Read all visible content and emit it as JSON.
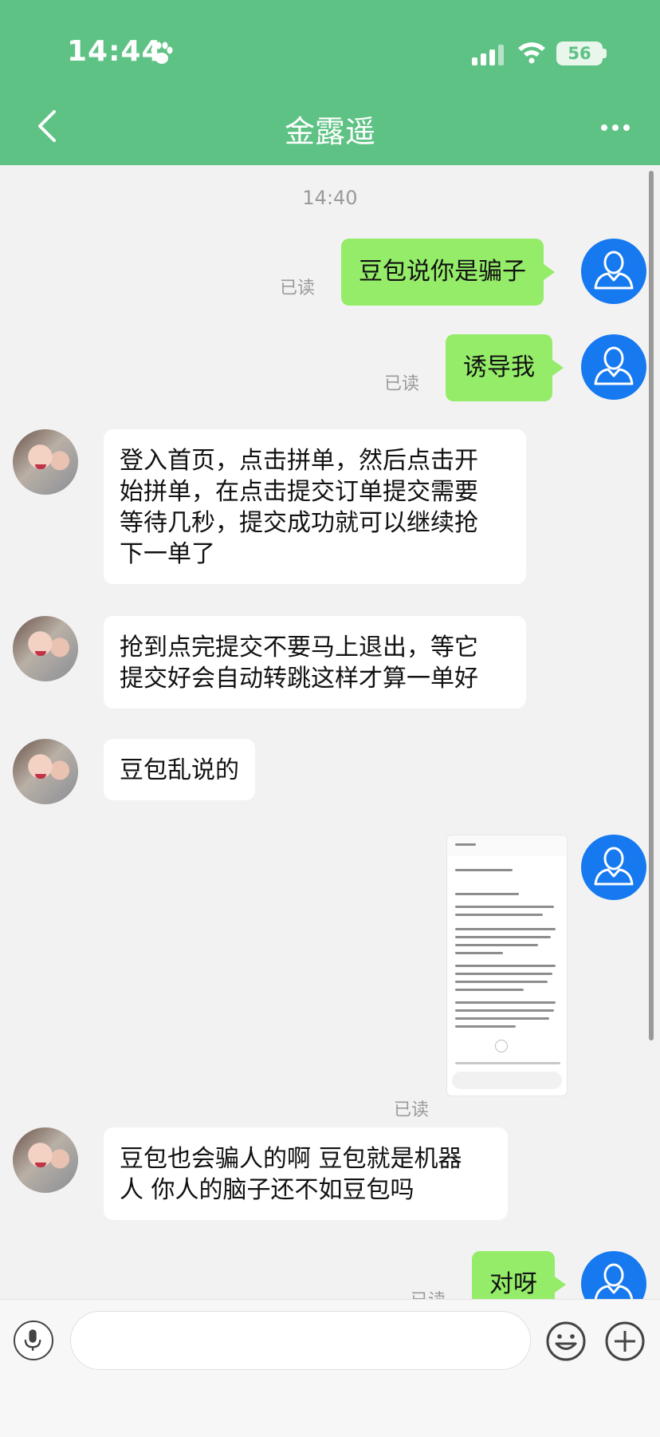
{
  "status_bar": {
    "time": "14:44",
    "battery": "56",
    "icons": [
      "paw-icon",
      "signal-icon",
      "wifi-icon",
      "battery-icon"
    ]
  },
  "header": {
    "title": "金露遥",
    "back_icon": "chevron-left-icon",
    "more_icon": "more-icon"
  },
  "timestamp": "14:40",
  "messages": [
    {
      "id": "m1",
      "side": "out",
      "text": "豆包说你是骗子",
      "read": "已读"
    },
    {
      "id": "m2",
      "side": "out",
      "text": "诱导我",
      "read": "已读"
    },
    {
      "id": "m3",
      "side": "in",
      "lines": [
        "登入首页，点击拼单，然后点击开",
        "始拼单，在点击提交订单提交需要",
        "等待几秒，提交成功就可以继续抢",
        "下一单了"
      ]
    },
    {
      "id": "m4",
      "side": "in",
      "lines": [
        "抢到点完提交不要马上退出，等它",
        "提交好会自动转跳这样才算一单好"
      ]
    },
    {
      "id": "m5",
      "side": "in",
      "text": "豆包乱说的"
    },
    {
      "id": "m6",
      "side": "out",
      "type": "image",
      "read": "已读"
    },
    {
      "id": "m7",
      "side": "in",
      "lines": [
        "豆包也会骗人的啊 豆包就是机器",
        "人 你人的脑子还不如豆包吗"
      ]
    },
    {
      "id": "m8",
      "side": "out",
      "text": "对呀",
      "read": "已读"
    }
  ],
  "input": {
    "value": "",
    "icons": [
      "microphone-icon",
      "emoji-icon",
      "plus-icon"
    ]
  },
  "colors": {
    "header": "#5ec284",
    "bubble_out": "#95ec69",
    "bubble_in": "#ffffff",
    "user_avatar": "#1679f0",
    "background": "#f2f2f2"
  }
}
